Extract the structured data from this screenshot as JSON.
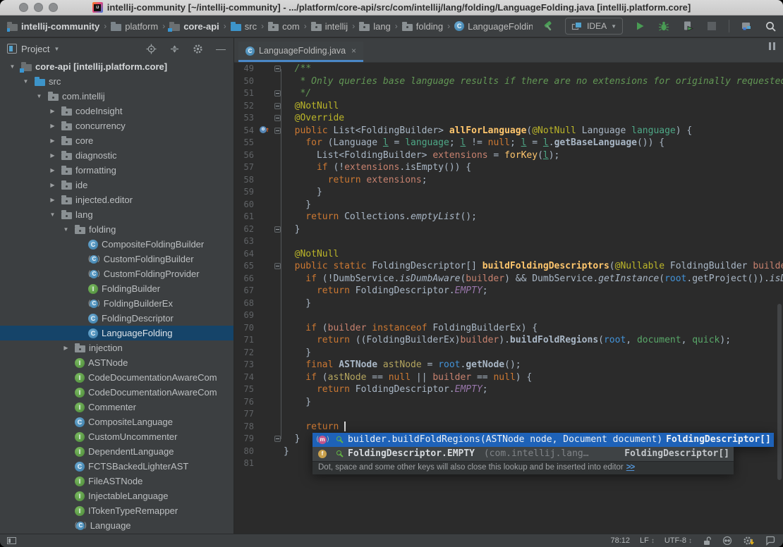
{
  "colors": {
    "editor_bg": "#2b2b2b",
    "panel_bg": "#3c3f41",
    "selection_blue": "#154469",
    "tab_underline": "#4A88C7",
    "popup_selection": "#1e62b8",
    "run_green": "#499C54",
    "keyword_orange": "#cc7832",
    "annotation_yellow": "#bbb529",
    "comment_green": "#629755"
  },
  "window": {
    "title": "intellij-community [~/intellij-community] - .../platform/core-api/src/com/intellij/lang/folding/LanguageFolding.java [intellij.platform.core]"
  },
  "breadcrumbs": [
    {
      "label": "intellij-community",
      "icon": "module-folder",
      "bold": true
    },
    {
      "label": "platform",
      "icon": "folder",
      "bold": false
    },
    {
      "label": "core-api",
      "icon": "module-folder",
      "bold": true
    },
    {
      "label": "src",
      "icon": "source-folder",
      "bold": false
    },
    {
      "label": "com",
      "icon": "package-folder",
      "bold": false
    },
    {
      "label": "intellij",
      "icon": "package-folder",
      "bold": false
    },
    {
      "label": "lang",
      "icon": "package-folder",
      "bold": false
    },
    {
      "label": "folding",
      "icon": "package-folder",
      "bold": false
    },
    {
      "label": "LanguageFolding",
      "icon": "class",
      "bold": false
    }
  ],
  "toolbar": {
    "run_config": "IDEA"
  },
  "project_panel": {
    "title": "Project",
    "tree": [
      {
        "label": "core-api [intellij.platform.core]",
        "icon": "module-folder",
        "indent": 0,
        "arrow": "down",
        "bold": true
      },
      {
        "label": "src",
        "icon": "source-folder",
        "indent": 1,
        "arrow": "down"
      },
      {
        "label": "com.intellij",
        "icon": "package-folder",
        "indent": 2,
        "arrow": "down"
      },
      {
        "label": "codeInsight",
        "icon": "package-folder",
        "indent": 3,
        "arrow": "right"
      },
      {
        "label": "concurrency",
        "icon": "package-folder",
        "indent": 3,
        "arrow": "right"
      },
      {
        "label": "core",
        "icon": "package-folder",
        "indent": 3,
        "arrow": "right"
      },
      {
        "label": "diagnostic",
        "icon": "package-folder",
        "indent": 3,
        "arrow": "right"
      },
      {
        "label": "formatting",
        "icon": "package-folder",
        "indent": 3,
        "arrow": "right"
      },
      {
        "label": "ide",
        "icon": "package-folder",
        "indent": 3,
        "arrow": "right"
      },
      {
        "label": "injected.editor",
        "icon": "package-folder",
        "indent": 3,
        "arrow": "right"
      },
      {
        "label": "lang",
        "icon": "package-folder",
        "indent": 3,
        "arrow": "down"
      },
      {
        "label": "folding",
        "icon": "package-folder",
        "indent": 4,
        "arrow": "down"
      },
      {
        "label": "CompositeFoldingBuilder",
        "icon": "class",
        "indent": 5
      },
      {
        "label": "CustomFoldingBuilder",
        "icon": "abstract-class",
        "indent": 5
      },
      {
        "label": "CustomFoldingProvider",
        "icon": "abstract-class",
        "indent": 5
      },
      {
        "label": "FoldingBuilder",
        "icon": "interface",
        "indent": 5
      },
      {
        "label": "FoldingBuilderEx",
        "icon": "abstract-class",
        "indent": 5
      },
      {
        "label": "FoldingDescriptor",
        "icon": "class",
        "indent": 5
      },
      {
        "label": "LanguageFolding",
        "icon": "class",
        "indent": 5,
        "selected": true
      },
      {
        "label": "injection",
        "icon": "package-folder",
        "indent": 4,
        "arrow": "right"
      },
      {
        "label": "ASTNode",
        "icon": "interface",
        "indent": 4
      },
      {
        "label": "CodeDocumentationAwareCom",
        "icon": "interface",
        "indent": 4
      },
      {
        "label": "CodeDocumentationAwareCom",
        "icon": "interface",
        "indent": 4
      },
      {
        "label": "Commenter",
        "icon": "interface",
        "indent": 4
      },
      {
        "label": "CompositeLanguage",
        "icon": "class",
        "indent": 4
      },
      {
        "label": "CustomUncommenter",
        "icon": "interface",
        "indent": 4
      },
      {
        "label": "DependentLanguage",
        "icon": "interface",
        "indent": 4
      },
      {
        "label": "FCTSBackedLighterAST",
        "icon": "class",
        "indent": 4
      },
      {
        "label": "FileASTNode",
        "icon": "interface",
        "indent": 4
      },
      {
        "label": "InjectableLanguage",
        "icon": "interface",
        "indent": 4
      },
      {
        "label": "ITokenTypeRemapper",
        "icon": "interface",
        "indent": 4
      },
      {
        "label": "Language",
        "icon": "abstract-class",
        "indent": 4
      }
    ]
  },
  "editor": {
    "tab": {
      "label": "LanguageFolding.java"
    },
    "lines": [
      {
        "n": 49,
        "fold": true,
        "seg": [
          [
            "c",
            "  /**"
          ]
        ]
      },
      {
        "n": 50,
        "seg": [
          [
            "c",
            "   * Only queries base language results if there are no extensions for originally requested"
          ]
        ]
      },
      {
        "n": 51,
        "fold": true,
        "seg": [
          [
            "c",
            "   */"
          ]
        ]
      },
      {
        "n": 52,
        "fold": true,
        "seg": [
          [
            "a",
            "  @NotNull"
          ]
        ]
      },
      {
        "n": 53,
        "fold": true,
        "seg": [
          [
            "a",
            "  @Override"
          ]
        ]
      },
      {
        "n": 54,
        "fold": true,
        "ovr": true,
        "seg": [
          [
            "k",
            "  public "
          ],
          [
            "p",
            "List<FoldingBuilder> "
          ],
          [
            "d",
            "allForLanguage"
          ],
          [
            "p",
            "("
          ],
          [
            "a",
            "@NotNull"
          ],
          [
            "p",
            " Language "
          ],
          [
            "v1",
            "language"
          ],
          [
            "p",
            ") {"
          ]
        ]
      },
      {
        "n": 55,
        "seg": [
          [
            "k",
            "    for "
          ],
          [
            "p",
            "(Language "
          ],
          [
            "v1u",
            "l"
          ],
          [
            "p",
            " = "
          ],
          [
            "v1",
            "language"
          ],
          [
            "p",
            "; "
          ],
          [
            "v1u",
            "l"
          ],
          [
            "p",
            " != "
          ],
          [
            "k",
            "null"
          ],
          [
            "p",
            "; "
          ],
          [
            "v1u",
            "l"
          ],
          [
            "p",
            " = "
          ],
          [
            "v1u",
            "l"
          ],
          [
            "p",
            "."
          ],
          [
            "pb",
            "getBaseLanguage"
          ],
          [
            "p",
            "()) {"
          ]
        ]
      },
      {
        "n": 56,
        "seg": [
          [
            "p",
            "      List<FoldingBuilder> "
          ],
          [
            "v3",
            "extensions"
          ],
          [
            "p",
            " = "
          ],
          [
            "y",
            "forKey"
          ],
          [
            "p",
            "("
          ],
          [
            "v1u",
            "l"
          ],
          [
            "p",
            ");"
          ]
        ]
      },
      {
        "n": 57,
        "seg": [
          [
            "k",
            "      if "
          ],
          [
            "p",
            "(!"
          ],
          [
            "v3",
            "extensions"
          ],
          [
            "p",
            ".isEmpty()) {"
          ]
        ]
      },
      {
        "n": 58,
        "seg": [
          [
            "k",
            "        return "
          ],
          [
            "v3",
            "extensions"
          ],
          [
            "p",
            ";"
          ]
        ]
      },
      {
        "n": 59,
        "seg": [
          [
            "p",
            "      }"
          ]
        ]
      },
      {
        "n": 60,
        "seg": [
          [
            "p",
            "    }"
          ]
        ]
      },
      {
        "n": 61,
        "seg": [
          [
            "k",
            "    return "
          ],
          [
            "p",
            "Collections."
          ],
          [
            "pi",
            "emptyList"
          ],
          [
            "p",
            "();"
          ]
        ]
      },
      {
        "n": 62,
        "fold": true,
        "seg": [
          [
            "p",
            "  }"
          ]
        ]
      },
      {
        "n": 63,
        "seg": []
      },
      {
        "n": 64,
        "seg": [
          [
            "a",
            "  @NotNull"
          ]
        ]
      },
      {
        "n": 65,
        "fold": true,
        "seg": [
          [
            "k",
            "  public static "
          ],
          [
            "p",
            "FoldingDescriptor[] "
          ],
          [
            "d",
            "buildFoldingDescriptors"
          ],
          [
            "p",
            "("
          ],
          [
            "a",
            "@Nullable"
          ],
          [
            "p",
            " FoldingBuilder "
          ],
          [
            "v3",
            "builder"
          ]
        ]
      },
      {
        "n": 66,
        "seg": [
          [
            "k",
            "    if "
          ],
          [
            "p",
            "(!DumbService."
          ],
          [
            "pi",
            "isDumbAware"
          ],
          [
            "p",
            "("
          ],
          [
            "v3",
            "builder"
          ],
          [
            "p",
            ") && DumbService."
          ],
          [
            "pi",
            "getInstance"
          ],
          [
            "p",
            "("
          ],
          [
            "v4",
            "root"
          ],
          [
            "p",
            ".getProject())."
          ],
          [
            "pi",
            "isDum"
          ]
        ]
      },
      {
        "n": 67,
        "seg": [
          [
            "k",
            "      return "
          ],
          [
            "p",
            "FoldingDescriptor."
          ],
          [
            "f",
            "EMPTY"
          ],
          [
            "p",
            ";"
          ]
        ]
      },
      {
        "n": 68,
        "seg": [
          [
            "p",
            "    }"
          ]
        ]
      },
      {
        "n": 69,
        "seg": []
      },
      {
        "n": 70,
        "seg": [
          [
            "k",
            "    if "
          ],
          [
            "p",
            "("
          ],
          [
            "v3",
            "builder"
          ],
          [
            "k",
            " instanceof "
          ],
          [
            "p",
            "FoldingBuilderEx) {"
          ]
        ]
      },
      {
        "n": 71,
        "seg": [
          [
            "k",
            "      return "
          ],
          [
            "p",
            "((FoldingBuilderEx)"
          ],
          [
            "v3",
            "builder"
          ],
          [
            "p",
            ")."
          ],
          [
            "pb",
            "buildFoldRegions"
          ],
          [
            "p",
            "("
          ],
          [
            "v4",
            "root"
          ],
          [
            "p",
            ", "
          ],
          [
            "v2",
            "document"
          ],
          [
            "p",
            ", "
          ],
          [
            "v2",
            "quick"
          ],
          [
            "p",
            ");"
          ]
        ]
      },
      {
        "n": 72,
        "seg": [
          [
            "p",
            "    }"
          ]
        ]
      },
      {
        "n": 73,
        "seg": [
          [
            "k",
            "    final "
          ],
          [
            "pb",
            "ASTNode "
          ],
          [
            "v5",
            "astNode"
          ],
          [
            "p",
            " = "
          ],
          [
            "v4",
            "root"
          ],
          [
            "p",
            "."
          ],
          [
            "pb",
            "getNode"
          ],
          [
            "p",
            "();"
          ]
        ]
      },
      {
        "n": 74,
        "seg": [
          [
            "k",
            "    if "
          ],
          [
            "p",
            "("
          ],
          [
            "v5",
            "astNode"
          ],
          [
            "p",
            " == "
          ],
          [
            "k",
            "null"
          ],
          [
            "p",
            " || "
          ],
          [
            "v3",
            "builder"
          ],
          [
            "p",
            " == "
          ],
          [
            "k",
            "null"
          ],
          [
            "p",
            ") {"
          ]
        ]
      },
      {
        "n": 75,
        "seg": [
          [
            "k",
            "      return "
          ],
          [
            "p",
            "FoldingDescriptor."
          ],
          [
            "f",
            "EMPTY"
          ],
          [
            "p",
            ";"
          ]
        ]
      },
      {
        "n": 76,
        "seg": [
          [
            "p",
            "    }"
          ]
        ]
      },
      {
        "n": 77,
        "seg": []
      },
      {
        "n": 78,
        "caret": true,
        "seg": [
          [
            "k",
            "    return"
          ],
          [
            "p",
            " "
          ]
        ]
      },
      {
        "n": 79,
        "fold": true,
        "seg": [
          [
            "p",
            "  }"
          ]
        ]
      },
      {
        "n": 80,
        "seg": [
          [
            "p",
            "}"
          ]
        ]
      },
      {
        "n": 81,
        "seg": []
      }
    ]
  },
  "completion": {
    "items": [
      {
        "kind": "method",
        "label": "builder.buildFoldRegions(ASTNode node, Document document)",
        "pkg": "",
        "type": "FoldingDescriptor[]",
        "selected": true,
        "bold": false
      },
      {
        "kind": "field",
        "label": "FoldingDescriptor.EMPTY",
        "pkg": " (com.intellij.lang…",
        "type": "FoldingDescriptor[]",
        "selected": false,
        "bold": true
      }
    ],
    "hint": {
      "text": "Dot, space and some other keys will also close this lookup and be inserted into editor",
      "link": ">>"
    }
  },
  "status_bar": {
    "caret_position": "78:12",
    "line_separator": "LF",
    "encoding": "UTF-8"
  }
}
